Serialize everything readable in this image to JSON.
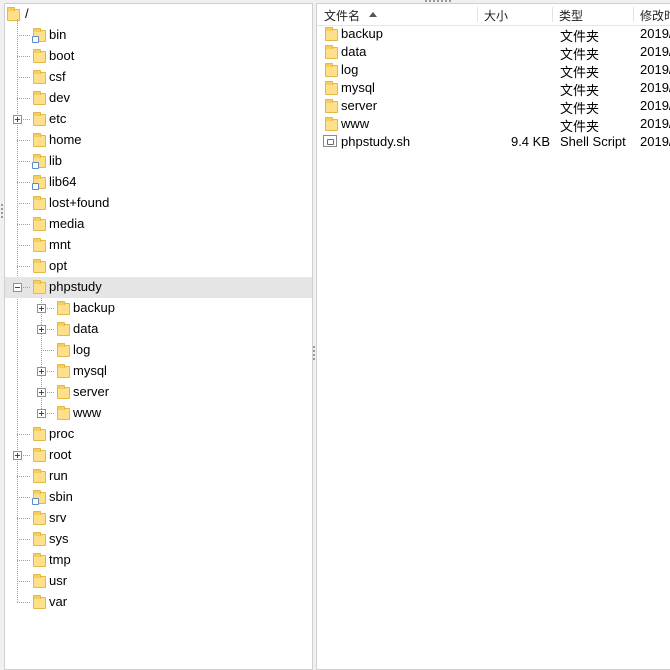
{
  "tree": {
    "root": "/",
    "items": [
      {
        "label": "bin",
        "expander": "none",
        "link": true
      },
      {
        "label": "boot",
        "expander": "none",
        "link": false
      },
      {
        "label": "csf",
        "expander": "none",
        "link": false
      },
      {
        "label": "dev",
        "expander": "none",
        "link": false
      },
      {
        "label": "etc",
        "expander": "plus",
        "link": false
      },
      {
        "label": "home",
        "expander": "none",
        "link": false
      },
      {
        "label": "lib",
        "expander": "none",
        "link": true
      },
      {
        "label": "lib64",
        "expander": "none",
        "link": true
      },
      {
        "label": "lost+found",
        "expander": "none",
        "link": false
      },
      {
        "label": "media",
        "expander": "none",
        "link": false
      },
      {
        "label": "mnt",
        "expander": "none",
        "link": false
      },
      {
        "label": "opt",
        "expander": "none",
        "link": false
      },
      {
        "label": "phpstudy",
        "expander": "minus",
        "link": false,
        "selected": true,
        "children": [
          {
            "label": "backup",
            "expander": "plus"
          },
          {
            "label": "data",
            "expander": "plus"
          },
          {
            "label": "log",
            "expander": "none"
          },
          {
            "label": "mysql",
            "expander": "plus"
          },
          {
            "label": "server",
            "expander": "plus"
          },
          {
            "label": "www",
            "expander": "plus"
          }
        ]
      },
      {
        "label": "proc",
        "expander": "none",
        "link": false
      },
      {
        "label": "root",
        "expander": "plus",
        "link": false
      },
      {
        "label": "run",
        "expander": "none",
        "link": false
      },
      {
        "label": "sbin",
        "expander": "none",
        "link": true
      },
      {
        "label": "srv",
        "expander": "none",
        "link": false
      },
      {
        "label": "sys",
        "expander": "none",
        "link": false
      },
      {
        "label": "tmp",
        "expander": "none",
        "link": false
      },
      {
        "label": "usr",
        "expander": "none",
        "link": false
      },
      {
        "label": "var",
        "expander": "none",
        "link": false
      }
    ]
  },
  "list": {
    "columns": {
      "name": "文件名",
      "size": "大小",
      "type": "类型",
      "modified": "修改时"
    },
    "rows": [
      {
        "name": "backup",
        "size": "",
        "type": "文件夹",
        "modified": "2019/",
        "kind": "folder"
      },
      {
        "name": "data",
        "size": "",
        "type": "文件夹",
        "modified": "2019/",
        "kind": "folder"
      },
      {
        "name": "log",
        "size": "",
        "type": "文件夹",
        "modified": "2019/",
        "kind": "folder"
      },
      {
        "name": "mysql",
        "size": "",
        "type": "文件夹",
        "modified": "2019/",
        "kind": "folder"
      },
      {
        "name": "server",
        "size": "",
        "type": "文件夹",
        "modified": "2019/",
        "kind": "folder"
      },
      {
        "name": "www",
        "size": "",
        "type": "文件夹",
        "modified": "2019/",
        "kind": "folder"
      },
      {
        "name": "phpstudy.sh",
        "size": "9.4 KB",
        "type": "Shell Script",
        "modified": "2019/",
        "kind": "file"
      }
    ]
  }
}
